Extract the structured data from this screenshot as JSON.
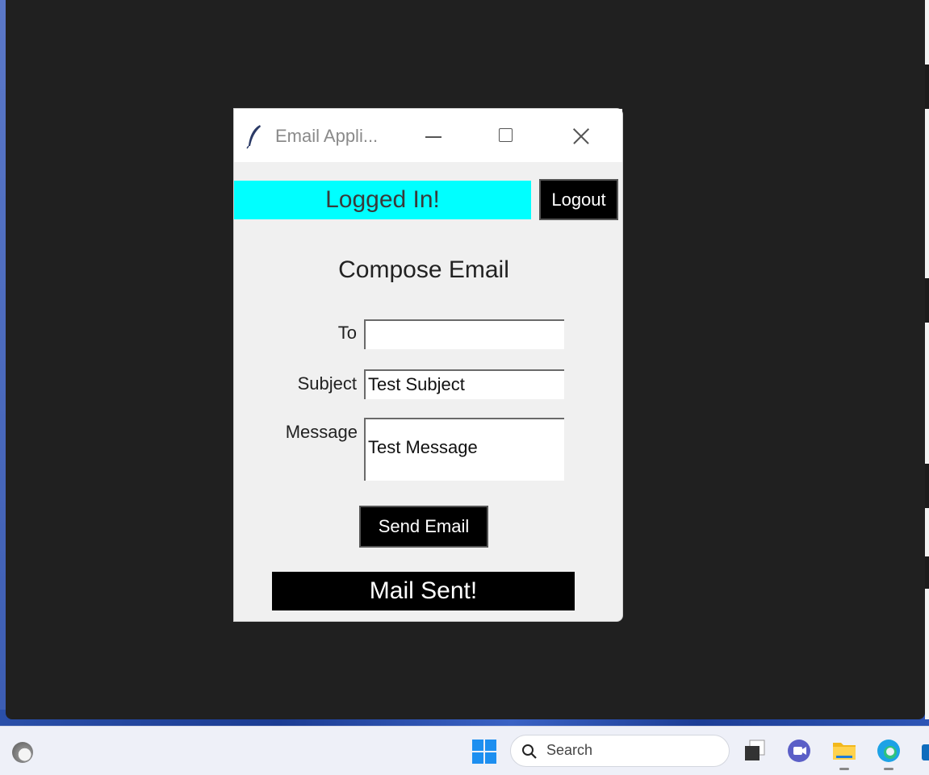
{
  "window": {
    "title": "Email Appli...",
    "minimize_icon": "minimize-icon",
    "maximize_icon": "maximize-icon",
    "close_icon": "close-icon",
    "app_icon": "feather-icon"
  },
  "status": {
    "text": "Logged In!",
    "color": "#00ffff"
  },
  "logout": {
    "label": "Logout"
  },
  "compose": {
    "heading": "Compose Email",
    "to_label": "To",
    "to_value": "",
    "subject_label": "Subject",
    "subject_value": "Test Subject",
    "message_label": "Message",
    "message_value": "Test Message",
    "send_label": "Send Email"
  },
  "result": {
    "text": "Mail Sent!"
  },
  "taskbar": {
    "search_placeholder": "Search",
    "icons": [
      "widgets-icon",
      "windows-start-icon",
      "search-icon",
      "task-view-icon",
      "teams-meet-icon",
      "file-explorer-icon",
      "edge-icon",
      "store-icon"
    ]
  }
}
